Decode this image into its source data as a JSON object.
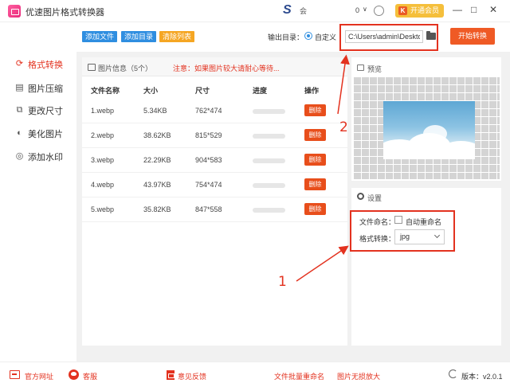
{
  "window": {
    "title": "优速图片格式转换器",
    "user": "会",
    "count": "0",
    "vip_label": "开通会员",
    "minimize": "—",
    "maximize": "□",
    "close": "✕"
  },
  "sidebar": {
    "items": [
      {
        "label": "格式转换",
        "icon": "refresh-icon",
        "active": true
      },
      {
        "label": "图片压缩",
        "icon": "compress-icon",
        "active": false
      },
      {
        "label": "更改尺寸",
        "icon": "resize-icon",
        "active": false
      },
      {
        "label": "美化图片",
        "icon": "beautify-icon",
        "active": false
      },
      {
        "label": "添加水印",
        "icon": "watermark-icon",
        "active": false
      }
    ]
  },
  "toolbar": {
    "add_file": "添加文件",
    "add_dir": "添加目录",
    "clear_list": "清除列表",
    "output_label": "输出目录：",
    "custom_label": "自定义",
    "path_value": "C:\\Users\\admin\\Desktop",
    "start": "开始转换"
  },
  "file_panel": {
    "title": "图片信息（5个）",
    "note": "注意：如果图片较大请耐心等待...",
    "columns": [
      "文件名称",
      "大小",
      "尺寸",
      "进度",
      "操作"
    ],
    "delete_label": "删除",
    "rows": [
      {
        "name": "1.webp",
        "size": "5.34KB",
        "dims": "762*474",
        "progress": 0
      },
      {
        "name": "2.webp",
        "size": "38.62KB",
        "dims": "815*529",
        "progress": 0
      },
      {
        "name": "3.webp",
        "size": "22.29KB",
        "dims": "904*583",
        "progress": 0
      },
      {
        "name": "4.webp",
        "size": "43.97KB",
        "dims": "754*474",
        "progress": 0
      },
      {
        "name": "5.webp",
        "size": "35.82KB",
        "dims": "847*558",
        "progress": 0
      }
    ]
  },
  "preview": {
    "title": "预览"
  },
  "settings": {
    "title": "设置",
    "naming_label": "文件命名：",
    "auto_rename": "自动重命名",
    "auto_rename_checked": false,
    "format_label": "格式转换：",
    "format_value": "jpg"
  },
  "annotations": {
    "num1": "1",
    "num2": "2"
  },
  "footer": {
    "website": "官方网址",
    "service": "客服",
    "feedback": "意见反馈",
    "batch_rename": "文件批量重命名",
    "lossless_enlarge": "图片无损放大",
    "version": "版本：v2.0.1"
  },
  "colors": {
    "accent": "#e3321f",
    "blue": "#2f8ee0",
    "orange": "#ef5a25"
  }
}
